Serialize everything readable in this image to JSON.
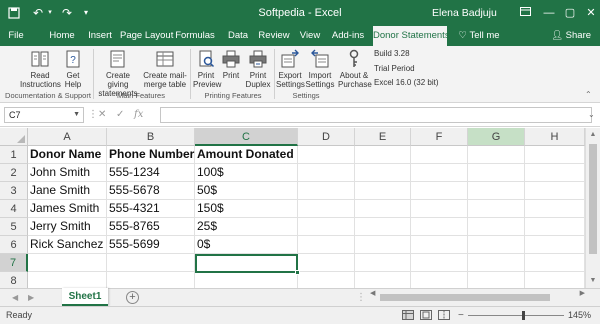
{
  "titlebar": {
    "title": "Softpedia - Excel",
    "user": "Elena Badjuju",
    "accent": "#217346"
  },
  "ribbon_tabs": [
    {
      "label": "File"
    },
    {
      "label": "Home"
    },
    {
      "label": "Insert"
    },
    {
      "label": "Page Layout"
    },
    {
      "label": "Formulas"
    },
    {
      "label": "Data"
    },
    {
      "label": "Review"
    },
    {
      "label": "View"
    },
    {
      "label": "Add-ins"
    },
    {
      "label": "Donor Statements"
    },
    {
      "label": "Tell me"
    },
    {
      "label": "Share"
    }
  ],
  "ribbon": {
    "buttons": {
      "read": "Read Instructions",
      "help": "Get Help",
      "create_giving": "Create giving statements",
      "create_mail": "Create mail-merge table",
      "print_preview": "Print Preview",
      "print": "Print",
      "print_duplex": "Print Duplex",
      "export": "Export Settings",
      "import": "Import Settings",
      "about": "About & Purchase"
    },
    "groups": {
      "doc_support": "Documentation & Support",
      "main": "Main Features",
      "printing": "Printing Features",
      "settings": "Settings"
    },
    "info": {
      "build": "Build 3.28",
      "trial": "Trial Period",
      "version": "Excel 16.0 (32 bit)"
    }
  },
  "formula_bar": {
    "name_box": "C7",
    "formula": ""
  },
  "columns": [
    "A",
    "B",
    "C",
    "D",
    "E",
    "F",
    "G",
    "H"
  ],
  "rows": [
    "1",
    "2",
    "3",
    "4",
    "5",
    "6",
    "7",
    "8"
  ],
  "sheet": {
    "headers": [
      "Donor Name",
      "Phone Number",
      "Amount Donated"
    ],
    "data": [
      [
        "John Smith",
        "555-1234",
        "100$"
      ],
      [
        "Jane Smith",
        "555-5678",
        "50$"
      ],
      [
        "James Smith",
        "555-4321",
        "150$"
      ],
      [
        "Jerry Smith",
        "555-8765",
        "25$"
      ],
      [
        "Rick Sanchez",
        "555-5699",
        "0$"
      ]
    ]
  },
  "sheet_tabs": [
    {
      "label": "Sheet1"
    }
  ],
  "status": {
    "text": "Ready",
    "zoom": "145%",
    "zoom_fraction": 0.58
  }
}
